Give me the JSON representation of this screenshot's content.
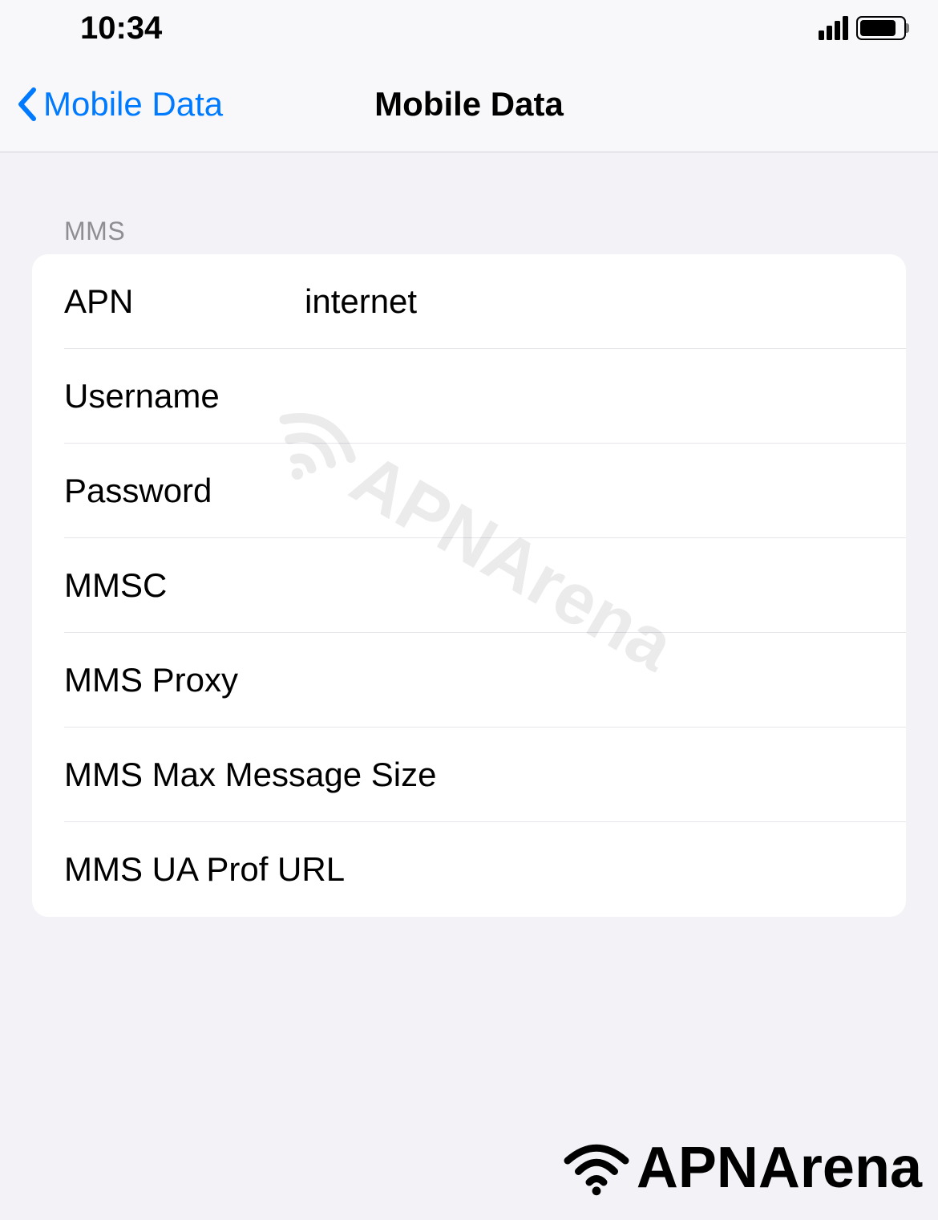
{
  "status_bar": {
    "time": "10:34"
  },
  "nav": {
    "back_label": "Mobile Data",
    "title": "Mobile Data"
  },
  "section": {
    "header": "MMS",
    "rows": [
      {
        "label": "APN",
        "value": "internet"
      },
      {
        "label": "Username",
        "value": ""
      },
      {
        "label": "Password",
        "value": ""
      },
      {
        "label": "MMSC",
        "value": ""
      },
      {
        "label": "MMS Proxy",
        "value": ""
      },
      {
        "label": "MMS Max Message Size",
        "value": ""
      },
      {
        "label": "MMS UA Prof URL",
        "value": ""
      }
    ]
  },
  "watermark": {
    "text": "APNArena"
  }
}
